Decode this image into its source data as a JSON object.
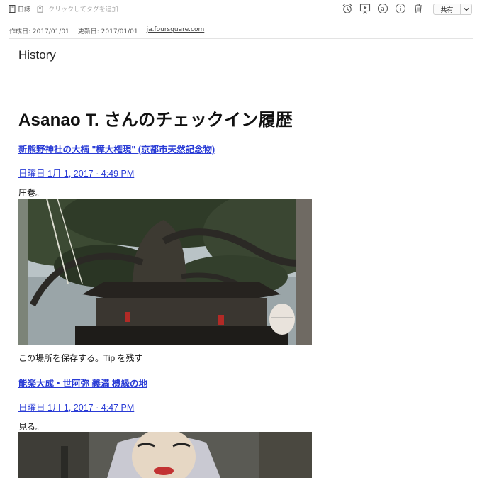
{
  "toolbar": {
    "notebook_label": "日誌",
    "tag_placeholder": "クリックしてタグを追加",
    "share_label": "共有"
  },
  "meta": {
    "created": "作成日: 2017/01/01",
    "updated": "更新日: 2017/01/01",
    "source_url": "ja.foursquare.com"
  },
  "note": {
    "title": "History",
    "heading": "Asanao T. さんのチェックイン履歴",
    "checkins": [
      {
        "venue": "新熊野神社の大楠 \"樟大権現\" (京都市天然記念物)",
        "date": "日曜日 1月 1, 2017 · 4:49 PM",
        "comment": "圧巻。",
        "after": "この場所を保存する。Tip を残す"
      },
      {
        "venue": "能楽大成・世阿弥 義満 機縁の地",
        "date": "日曜日 1月 1, 2017 · 4:47 PM",
        "comment": "見る。"
      }
    ]
  },
  "colors": {
    "link": "#2a3cd6",
    "accent_text": "#111111",
    "muted": "#a8a8a8"
  }
}
